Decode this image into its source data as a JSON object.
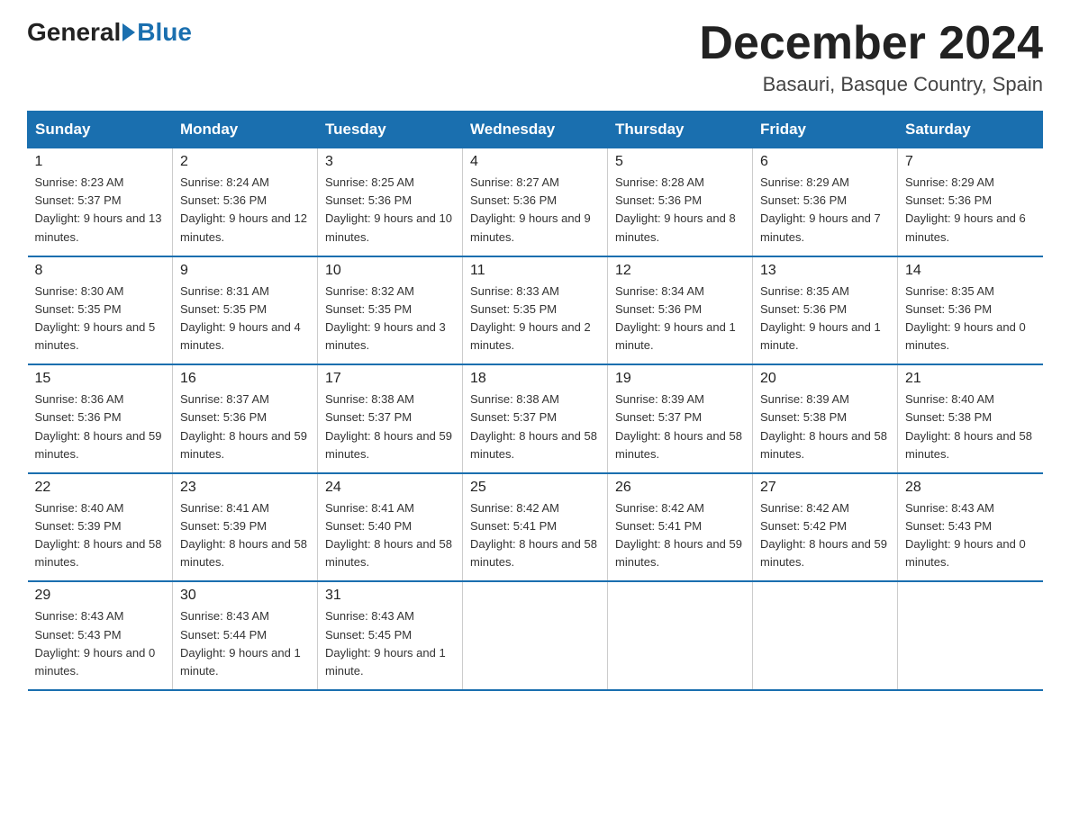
{
  "logo": {
    "general": "General",
    "blue": "Blue"
  },
  "title": "December 2024",
  "subtitle": "Basauri, Basque Country, Spain",
  "days_header": [
    "Sunday",
    "Monday",
    "Tuesday",
    "Wednesday",
    "Thursday",
    "Friday",
    "Saturday"
  ],
  "weeks": [
    [
      {
        "day": "1",
        "sunrise": "8:23 AM",
        "sunset": "5:37 PM",
        "daylight": "9 hours and 13 minutes."
      },
      {
        "day": "2",
        "sunrise": "8:24 AM",
        "sunset": "5:36 PM",
        "daylight": "9 hours and 12 minutes."
      },
      {
        "day": "3",
        "sunrise": "8:25 AM",
        "sunset": "5:36 PM",
        "daylight": "9 hours and 10 minutes."
      },
      {
        "day": "4",
        "sunrise": "8:27 AM",
        "sunset": "5:36 PM",
        "daylight": "9 hours and 9 minutes."
      },
      {
        "day": "5",
        "sunrise": "8:28 AM",
        "sunset": "5:36 PM",
        "daylight": "9 hours and 8 minutes."
      },
      {
        "day": "6",
        "sunrise": "8:29 AM",
        "sunset": "5:36 PM",
        "daylight": "9 hours and 7 minutes."
      },
      {
        "day": "7",
        "sunrise": "8:29 AM",
        "sunset": "5:36 PM",
        "daylight": "9 hours and 6 minutes."
      }
    ],
    [
      {
        "day": "8",
        "sunrise": "8:30 AM",
        "sunset": "5:35 PM",
        "daylight": "9 hours and 5 minutes."
      },
      {
        "day": "9",
        "sunrise": "8:31 AM",
        "sunset": "5:35 PM",
        "daylight": "9 hours and 4 minutes."
      },
      {
        "day": "10",
        "sunrise": "8:32 AM",
        "sunset": "5:35 PM",
        "daylight": "9 hours and 3 minutes."
      },
      {
        "day": "11",
        "sunrise": "8:33 AM",
        "sunset": "5:35 PM",
        "daylight": "9 hours and 2 minutes."
      },
      {
        "day": "12",
        "sunrise": "8:34 AM",
        "sunset": "5:36 PM",
        "daylight": "9 hours and 1 minute."
      },
      {
        "day": "13",
        "sunrise": "8:35 AM",
        "sunset": "5:36 PM",
        "daylight": "9 hours and 1 minute."
      },
      {
        "day": "14",
        "sunrise": "8:35 AM",
        "sunset": "5:36 PM",
        "daylight": "9 hours and 0 minutes."
      }
    ],
    [
      {
        "day": "15",
        "sunrise": "8:36 AM",
        "sunset": "5:36 PM",
        "daylight": "8 hours and 59 minutes."
      },
      {
        "day": "16",
        "sunrise": "8:37 AM",
        "sunset": "5:36 PM",
        "daylight": "8 hours and 59 minutes."
      },
      {
        "day": "17",
        "sunrise": "8:38 AM",
        "sunset": "5:37 PM",
        "daylight": "8 hours and 59 minutes."
      },
      {
        "day": "18",
        "sunrise": "8:38 AM",
        "sunset": "5:37 PM",
        "daylight": "8 hours and 58 minutes."
      },
      {
        "day": "19",
        "sunrise": "8:39 AM",
        "sunset": "5:37 PM",
        "daylight": "8 hours and 58 minutes."
      },
      {
        "day": "20",
        "sunrise": "8:39 AM",
        "sunset": "5:38 PM",
        "daylight": "8 hours and 58 minutes."
      },
      {
        "day": "21",
        "sunrise": "8:40 AM",
        "sunset": "5:38 PM",
        "daylight": "8 hours and 58 minutes."
      }
    ],
    [
      {
        "day": "22",
        "sunrise": "8:40 AM",
        "sunset": "5:39 PM",
        "daylight": "8 hours and 58 minutes."
      },
      {
        "day": "23",
        "sunrise": "8:41 AM",
        "sunset": "5:39 PM",
        "daylight": "8 hours and 58 minutes."
      },
      {
        "day": "24",
        "sunrise": "8:41 AM",
        "sunset": "5:40 PM",
        "daylight": "8 hours and 58 minutes."
      },
      {
        "day": "25",
        "sunrise": "8:42 AM",
        "sunset": "5:41 PM",
        "daylight": "8 hours and 58 minutes."
      },
      {
        "day": "26",
        "sunrise": "8:42 AM",
        "sunset": "5:41 PM",
        "daylight": "8 hours and 59 minutes."
      },
      {
        "day": "27",
        "sunrise": "8:42 AM",
        "sunset": "5:42 PM",
        "daylight": "8 hours and 59 minutes."
      },
      {
        "day": "28",
        "sunrise": "8:43 AM",
        "sunset": "5:43 PM",
        "daylight": "9 hours and 0 minutes."
      }
    ],
    [
      {
        "day": "29",
        "sunrise": "8:43 AM",
        "sunset": "5:43 PM",
        "daylight": "9 hours and 0 minutes."
      },
      {
        "day": "30",
        "sunrise": "8:43 AM",
        "sunset": "5:44 PM",
        "daylight": "9 hours and 1 minute."
      },
      {
        "day": "31",
        "sunrise": "8:43 AM",
        "sunset": "5:45 PM",
        "daylight": "9 hours and 1 minute."
      },
      null,
      null,
      null,
      null
    ]
  ]
}
